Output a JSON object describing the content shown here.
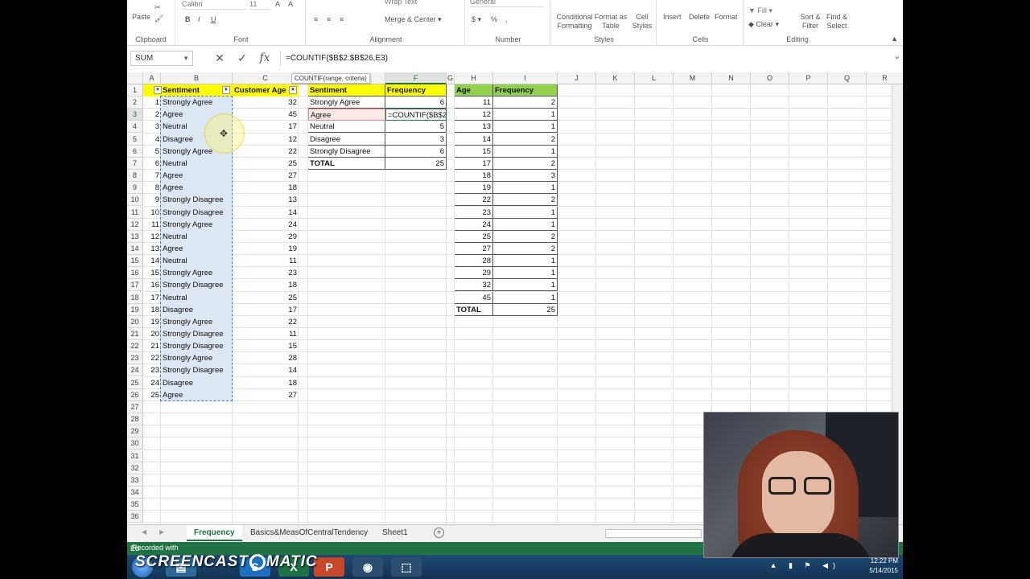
{
  "ribbon": {
    "groups": [
      "Clipboard",
      "Font",
      "Alignment",
      "Number",
      "Styles",
      "Cells",
      "Editing"
    ],
    "paste_label": "Paste",
    "font_name": "Calibri",
    "font_size": "11",
    "wrap_text": "Wrap Text",
    "merge_center": "Merge & Center",
    "number_format": "General",
    "conditional_formatting": "Conditional Formatting",
    "format_as_table": "Format as Table",
    "cell_styles": "Cell Styles",
    "insert": "Insert",
    "delete": "Delete",
    "format": "Format",
    "fill": "Fill",
    "clear": "Clear",
    "sort_filter": "Sort & Filter",
    "find_select": "Find & Select"
  },
  "formula_bar": {
    "name_box": "SUM",
    "formula": "=COUNTIF($B$2:$B$26,E3)",
    "tooltip": "COUNTIF(range, criteria)"
  },
  "columns": [
    "A",
    "B",
    "C",
    "D",
    "E",
    "F",
    "G",
    "H",
    "I",
    "J",
    "K",
    "L",
    "M",
    "N",
    "O",
    "P",
    "Q",
    "R"
  ],
  "rows": [
    "1",
    "2",
    "3",
    "4",
    "5",
    "6",
    "7",
    "8",
    "9",
    "10",
    "11",
    "12",
    "13",
    "14",
    "15",
    "16",
    "17",
    "18",
    "19",
    "20",
    "21",
    "22",
    "23",
    "24",
    "25",
    "26",
    "27",
    "28",
    "29",
    "30",
    "31",
    "32",
    "33",
    "34",
    "35",
    "36"
  ],
  "table1": {
    "headers": [
      "#",
      "Sentiment",
      "Customer Age"
    ],
    "rows": [
      [
        "1",
        "Strongly Agree",
        "32"
      ],
      [
        "2",
        "Agree",
        "45"
      ],
      [
        "3",
        "Neutral",
        "17"
      ],
      [
        "4",
        "Disagree",
        "12"
      ],
      [
        "5",
        "Strongly Agree",
        "22"
      ],
      [
        "6",
        "Neutral",
        "25"
      ],
      [
        "7",
        "Agree",
        "27"
      ],
      [
        "8",
        "Agree",
        "18"
      ],
      [
        "9",
        "Strongly Disagree",
        "13"
      ],
      [
        "10",
        "Strongly Disagree",
        "14"
      ],
      [
        "11",
        "Strongly Agree",
        "24"
      ],
      [
        "12",
        "Neutral",
        "29"
      ],
      [
        "13",
        "Agree",
        "19"
      ],
      [
        "14",
        "Neutral",
        "11"
      ],
      [
        "15",
        "Strongly Agree",
        "23"
      ],
      [
        "16",
        "Strongly Disagree",
        "18"
      ],
      [
        "17",
        "Neutral",
        "25"
      ],
      [
        "18",
        "Disagree",
        "17"
      ],
      [
        "19",
        "Strongly Agree",
        "22"
      ],
      [
        "20",
        "Strongly Disagree",
        "11"
      ],
      [
        "21",
        "Strongly Disagree",
        "15"
      ],
      [
        "22",
        "Strongly Agree",
        "28"
      ],
      [
        "23",
        "Strongly Disagree",
        "14"
      ],
      [
        "24",
        "Disagree",
        "18"
      ],
      [
        "25",
        "Agree",
        "27"
      ]
    ]
  },
  "table2": {
    "headers": [
      "Sentiment",
      "Frequency"
    ],
    "rows": [
      [
        "Strongly Agree",
        "6"
      ],
      [
        "Agree",
        "=COUNTIF($B$2"
      ],
      [
        "Neutral",
        "5"
      ],
      [
        "Disagree",
        "3"
      ],
      [
        "Strongly Disagree",
        "6"
      ],
      [
        "TOTAL",
        "25"
      ]
    ]
  },
  "table3": {
    "headers": [
      "Age",
      "Frequency"
    ],
    "rows": [
      [
        "11",
        "2"
      ],
      [
        "12",
        "1"
      ],
      [
        "13",
        "1"
      ],
      [
        "14",
        "2"
      ],
      [
        "15",
        "1"
      ],
      [
        "17",
        "2"
      ],
      [
        "18",
        "3"
      ],
      [
        "19",
        "1"
      ],
      [
        "22",
        "2"
      ],
      [
        "23",
        "1"
      ],
      [
        "24",
        "1"
      ],
      [
        "25",
        "2"
      ],
      [
        "27",
        "2"
      ],
      [
        "28",
        "1"
      ],
      [
        "29",
        "1"
      ],
      [
        "32",
        "1"
      ],
      [
        "45",
        "1"
      ],
      [
        "TOTAL",
        "25"
      ]
    ]
  },
  "sheet_tabs": [
    "Frequency",
    "Basics&MeasOfCentralTendency",
    "Sheet1"
  ],
  "status_text": "Ed",
  "watermark": {
    "recorded": "Recorded with",
    "brand": "SCREENCAST",
    "brand2": "MATIC"
  },
  "clock": {
    "time": "12:22 PM",
    "date": "5/14/2015"
  },
  "colors": {
    "excel_green": "#217346",
    "header_yellow": "#ffff00",
    "header_green": "#92d050"
  }
}
